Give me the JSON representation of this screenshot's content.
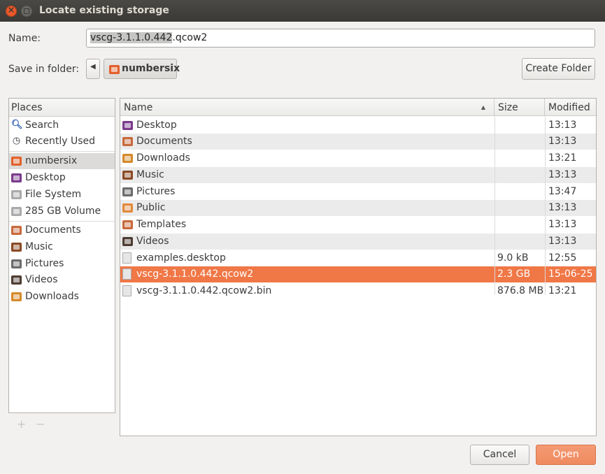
{
  "window": {
    "title": "Locate existing storage"
  },
  "name_field": {
    "label": "Name:",
    "value_selected": "vscg-3.1.1.0.442",
    "value_rest": ".qcow2"
  },
  "folder": {
    "label": "Save in folder:",
    "current": "numbersix",
    "create_folder": "Create Folder"
  },
  "places": {
    "header": "Places",
    "items": [
      {
        "label": "Search",
        "icon": "search-icon"
      },
      {
        "label": "Recently Used",
        "icon": "clock-icon"
      },
      {
        "label": "numbersix",
        "icon": "home-folder-icon",
        "selected": true
      },
      {
        "label": "Desktop",
        "icon": "desktop-folder-icon"
      },
      {
        "label": "File System",
        "icon": "drive-icon"
      },
      {
        "label": "285 GB Volume",
        "icon": "drive-icon"
      },
      {
        "label": "Documents",
        "icon": "documents-folder-icon"
      },
      {
        "label": "Music",
        "icon": "music-folder-icon"
      },
      {
        "label": "Pictures",
        "icon": "pictures-folder-icon"
      },
      {
        "label": "Videos",
        "icon": "videos-folder-icon"
      },
      {
        "label": "Downloads",
        "icon": "downloads-folder-icon"
      }
    ],
    "add": "+",
    "remove": "−"
  },
  "files": {
    "columns": {
      "name": "Name",
      "size": "Size",
      "modified": "Modified"
    },
    "sort_indicator": "▲",
    "rows": [
      {
        "name": "Desktop",
        "size": "",
        "modified": "13:13",
        "icon": "desktop-folder-icon"
      },
      {
        "name": "Documents",
        "size": "",
        "modified": "13:13",
        "icon": "documents-folder-icon"
      },
      {
        "name": "Downloads",
        "size": "",
        "modified": "13:21",
        "icon": "downloads-folder-icon"
      },
      {
        "name": "Music",
        "size": "",
        "modified": "13:13",
        "icon": "music-folder-icon"
      },
      {
        "name": "Pictures",
        "size": "",
        "modified": "13:47",
        "icon": "pictures-folder-icon"
      },
      {
        "name": "Public",
        "size": "",
        "modified": "13:13",
        "icon": "public-folder-icon"
      },
      {
        "name": "Templates",
        "size": "",
        "modified": "13:13",
        "icon": "templates-folder-icon"
      },
      {
        "name": "Videos",
        "size": "",
        "modified": "13:13",
        "icon": "videos-folder-icon"
      },
      {
        "name": "examples.desktop",
        "size": "9.0 kB",
        "modified": "12:55",
        "icon": "file-icon"
      },
      {
        "name": "vscg-3.1.1.0.442.qcow2",
        "size": "2.3 GB",
        "modified": "15-06-25",
        "icon": "file-icon",
        "selected": true
      },
      {
        "name": "vscg-3.1.1.0.442.qcow2.bin",
        "size": "876.8 MB",
        "modified": "13:21",
        "icon": "file-icon"
      }
    ]
  },
  "buttons": {
    "cancel": "Cancel",
    "open": "Open"
  },
  "colors": {
    "accent": "#f07746",
    "titlebar": "#3c3b37",
    "close": "#e9592a"
  }
}
